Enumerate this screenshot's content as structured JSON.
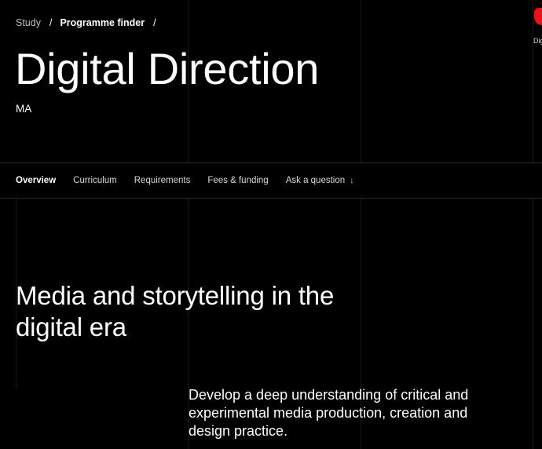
{
  "breadcrumb": {
    "items": [
      "Study",
      "Programme finder"
    ],
    "separator": "/"
  },
  "page": {
    "title": "Digital Direction",
    "subtitle": "MA"
  },
  "side_peek": {
    "text": "Dig"
  },
  "tabs": {
    "items": [
      {
        "label": "Overview",
        "active": true
      },
      {
        "label": "Curriculum",
        "active": false
      },
      {
        "label": "Requirements",
        "active": false
      },
      {
        "label": "Fees & funding",
        "active": false
      },
      {
        "label": "Ask a question",
        "active": false,
        "icon": "arrow-down-icon",
        "glyph": "↓"
      }
    ]
  },
  "hero": {
    "heading": "Media and storytelling in the digital era",
    "body": "Develop a deep understanding of critical and experimental media production, creation and design practice."
  },
  "colors": {
    "background": "#000000",
    "text": "#ffffff",
    "accent": "#e3151a"
  }
}
